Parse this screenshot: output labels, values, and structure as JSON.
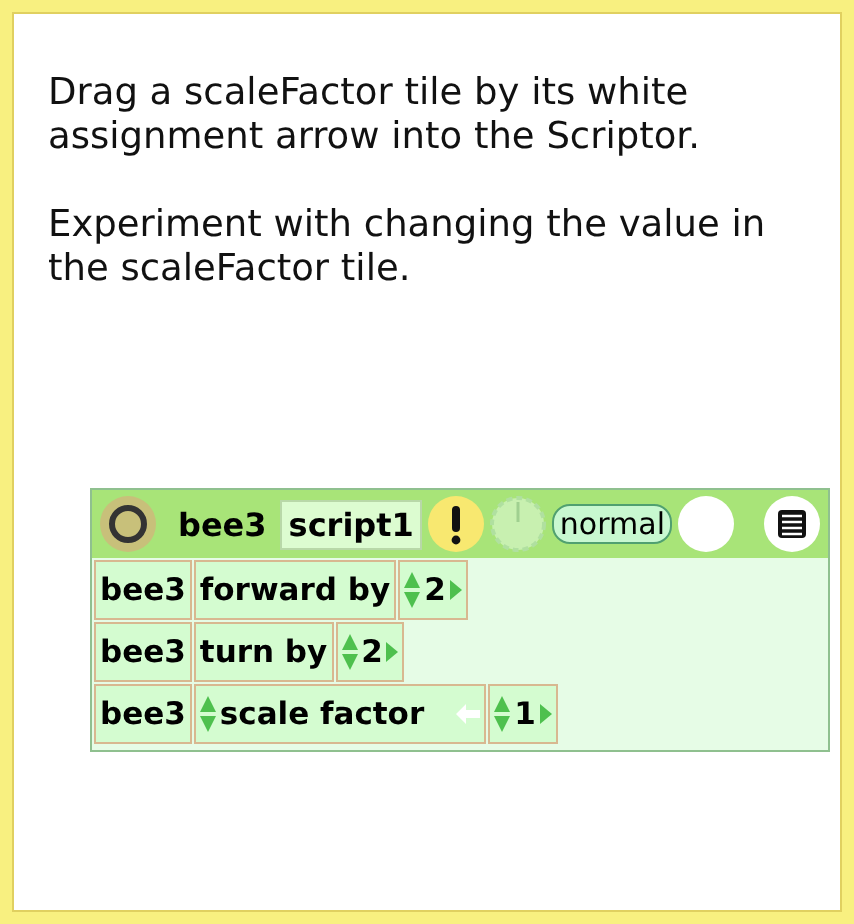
{
  "instructions": [
    "Drag a scaleFactor tile by its white assignment arrow into the Scriptor.",
    "Experiment with changing the value in the scaleFactor tile."
  ],
  "scriptor": {
    "object": "bee3",
    "script": "script1",
    "status": "normal",
    "rows": [
      {
        "kind": "command",
        "object": "bee3",
        "label": "forward by",
        "value": "2"
      },
      {
        "kind": "command",
        "object": "bee3",
        "label": "turn by",
        "value": "2"
      },
      {
        "kind": "assignment",
        "object": "bee3",
        "label": "scale factor",
        "value": "1"
      }
    ]
  }
}
